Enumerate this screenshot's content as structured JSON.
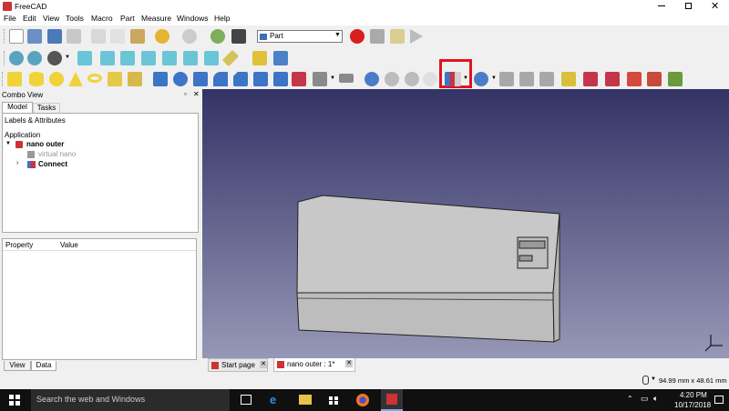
{
  "app": {
    "title": "FreeCAD"
  },
  "menu": [
    "File",
    "Edit",
    "View",
    "Tools",
    "Macro",
    "Part",
    "Measure",
    "Windows",
    "Help"
  ],
  "workbench": {
    "selected": "Part"
  },
  "combo": {
    "title": "Combo View",
    "tabs": [
      "Model",
      "Tasks"
    ],
    "section": "Labels & Attributes",
    "root": "Application",
    "doc": "nano outer",
    "child1": "virtual nano",
    "child2": "Connect",
    "prop_headers": [
      "Property",
      "Value"
    ],
    "bottom_tabs": [
      "View",
      "Data"
    ]
  },
  "doc_tabs": [
    "Start page",
    "nano outer : 1*"
  ],
  "status": {
    "dimensions": "94.99 mm x 48.61 mm"
  },
  "taskbar": {
    "search": "Search the web and Windows",
    "time": "4:20 PM",
    "date": "10/17/2018"
  },
  "colors": {
    "highlight": "#e0141c",
    "viewport_top": "#333366",
    "viewport_bottom": "#9797b7",
    "solid": "#c8c8c8"
  }
}
